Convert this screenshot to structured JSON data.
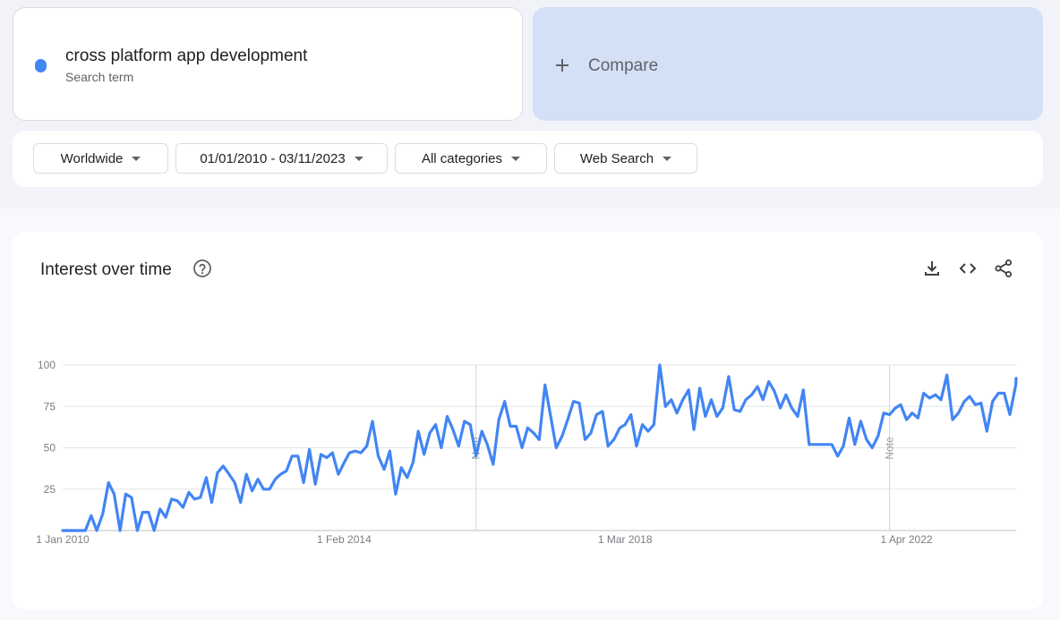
{
  "search_term": {
    "name": "cross platform app development",
    "sublabel": "Search term",
    "color": "#4285f4"
  },
  "compare": {
    "label": "Compare",
    "icon": "plus-icon"
  },
  "filters": {
    "region": "Worldwide",
    "date_range": "01/01/2010 - 03/11/2023",
    "category": "All categories",
    "search_type": "Web Search"
  },
  "panel": {
    "title": "Interest over time",
    "icons": [
      "help-icon",
      "download-icon",
      "embed-code-icon",
      "share-icon"
    ]
  },
  "chart_data": {
    "type": "line",
    "title": "",
    "xlabel": "",
    "ylabel": "",
    "ylim": [
      0,
      100
    ],
    "y_ticks": [
      25,
      50,
      75,
      100
    ],
    "x_range": [
      "2010-01-01",
      "2023-11-03"
    ],
    "x_ticks": [
      {
        "date": "2010-01-01",
        "label": "1 Jan 2010"
      },
      {
        "date": "2014-02-01",
        "label": "1 Feb 2014"
      },
      {
        "date": "2018-03-01",
        "label": "1 Mar 2018"
      },
      {
        "date": "2022-04-01",
        "label": "1 Apr 2022"
      }
    ],
    "notes": [
      {
        "date": "2016-01-01",
        "label": "Note"
      },
      {
        "date": "2022-01-01",
        "label": "Note"
      }
    ],
    "grid": true,
    "legend": "none",
    "series": [
      {
        "color": "#4285f4",
        "points": [
          [
            "2010-01-01",
            0
          ],
          [
            "2010-02-01",
            0
          ],
          [
            "2010-03-01",
            0
          ],
          [
            "2010-04-01",
            0
          ],
          [
            "2010-05-01",
            0
          ],
          [
            "2010-06-01",
            9
          ],
          [
            "2010-07-01",
            0
          ],
          [
            "2010-08-01",
            10
          ],
          [
            "2010-09-01",
            29
          ],
          [
            "2010-10-01",
            22
          ],
          [
            "2010-11-01",
            0
          ],
          [
            "2010-12-01",
            22
          ],
          [
            "2011-01-01",
            20
          ],
          [
            "2011-02-01",
            0
          ],
          [
            "2011-03-01",
            11
          ],
          [
            "2011-04-01",
            11
          ],
          [
            "2011-05-01",
            0
          ],
          [
            "2011-06-01",
            13
          ],
          [
            "2011-07-01",
            8
          ],
          [
            "2011-08-01",
            19
          ],
          [
            "2011-09-01",
            18
          ],
          [
            "2011-10-01",
            14
          ],
          [
            "2011-11-01",
            23
          ],
          [
            "2011-12-01",
            19
          ],
          [
            "2012-01-01",
            20
          ],
          [
            "2012-02-01",
            32
          ],
          [
            "2012-03-01",
            17
          ],
          [
            "2012-04-01",
            35
          ],
          [
            "2012-05-01",
            39
          ],
          [
            "2012-06-01",
            34
          ],
          [
            "2012-07-01",
            29
          ],
          [
            "2012-08-01",
            17
          ],
          [
            "2012-09-01",
            34
          ],
          [
            "2012-10-01",
            24
          ],
          [
            "2012-11-01",
            31
          ],
          [
            "2012-12-01",
            25
          ],
          [
            "2013-01-01",
            25
          ],
          [
            "2013-02-01",
            31
          ],
          [
            "2013-03-01",
            34
          ],
          [
            "2013-04-01",
            36
          ],
          [
            "2013-05-01",
            45
          ],
          [
            "2013-06-01",
            45
          ],
          [
            "2013-07-01",
            29
          ],
          [
            "2013-08-01",
            49
          ],
          [
            "2013-09-01",
            28
          ],
          [
            "2013-10-01",
            46
          ],
          [
            "2013-11-01",
            44
          ],
          [
            "2013-12-01",
            47
          ],
          [
            "2014-01-01",
            34
          ],
          [
            "2014-02-01",
            41
          ],
          [
            "2014-03-01",
            47
          ],
          [
            "2014-04-01",
            48
          ],
          [
            "2014-05-01",
            47
          ],
          [
            "2014-06-01",
            51
          ],
          [
            "2014-07-01",
            66
          ],
          [
            "2014-08-01",
            45
          ],
          [
            "2014-09-01",
            37
          ],
          [
            "2014-10-01",
            48
          ],
          [
            "2014-11-01",
            22
          ],
          [
            "2014-12-01",
            38
          ],
          [
            "2015-01-01",
            32
          ],
          [
            "2015-02-01",
            41
          ],
          [
            "2015-03-01",
            60
          ],
          [
            "2015-04-01",
            46
          ],
          [
            "2015-05-01",
            59
          ],
          [
            "2015-06-01",
            64
          ],
          [
            "2015-07-01",
            50
          ],
          [
            "2015-08-01",
            69
          ],
          [
            "2015-09-01",
            61
          ],
          [
            "2015-10-01",
            51
          ],
          [
            "2015-11-01",
            66
          ],
          [
            "2015-12-01",
            64
          ],
          [
            "2016-01-01",
            45
          ],
          [
            "2016-02-01",
            60
          ],
          [
            "2016-03-01",
            52
          ],
          [
            "2016-04-01",
            40
          ],
          [
            "2016-05-01",
            67
          ],
          [
            "2016-06-01",
            78
          ],
          [
            "2016-07-01",
            63
          ],
          [
            "2016-08-01",
            63
          ],
          [
            "2016-09-01",
            50
          ],
          [
            "2016-10-01",
            62
          ],
          [
            "2016-11-01",
            59
          ],
          [
            "2016-12-01",
            55
          ],
          [
            "2017-01-01",
            88
          ],
          [
            "2017-02-01",
            68
          ],
          [
            "2017-03-01",
            50
          ],
          [
            "2017-04-01",
            57
          ],
          [
            "2017-05-01",
            67
          ],
          [
            "2017-06-01",
            78
          ],
          [
            "2017-07-01",
            77
          ],
          [
            "2017-08-01",
            55
          ],
          [
            "2017-09-01",
            59
          ],
          [
            "2017-10-01",
            70
          ],
          [
            "2017-11-01",
            72
          ],
          [
            "2017-12-01",
            51
          ],
          [
            "2018-01-01",
            55
          ],
          [
            "2018-02-01",
            62
          ],
          [
            "2018-03-01",
            64
          ],
          [
            "2018-04-01",
            70
          ],
          [
            "2018-05-01",
            51
          ],
          [
            "2018-06-01",
            64
          ],
          [
            "2018-07-01",
            60
          ],
          [
            "2018-08-01",
            64
          ],
          [
            "2018-09-01",
            100
          ],
          [
            "2018-10-01",
            75
          ],
          [
            "2018-11-01",
            79
          ],
          [
            "2018-12-01",
            71
          ],
          [
            "2019-01-01",
            79
          ],
          [
            "2019-02-01",
            85
          ],
          [
            "2019-03-01",
            61
          ],
          [
            "2019-04-01",
            86
          ],
          [
            "2019-05-01",
            69
          ],
          [
            "2019-06-01",
            79
          ],
          [
            "2019-07-01",
            69
          ],
          [
            "2019-08-01",
            74
          ],
          [
            "2019-09-01",
            93
          ],
          [
            "2019-10-01",
            73
          ],
          [
            "2019-11-01",
            72
          ],
          [
            "2019-12-01",
            79
          ],
          [
            "2020-01-01",
            82
          ],
          [
            "2020-02-01",
            87
          ],
          [
            "2020-03-01",
            79
          ],
          [
            "2020-04-01",
            90
          ],
          [
            "2020-05-01",
            84
          ],
          [
            "2020-06-01",
            74
          ],
          [
            "2020-07-01",
            82
          ],
          [
            "2020-08-01",
            74
          ],
          [
            "2020-09-01",
            69
          ],
          [
            "2020-10-01",
            85
          ],
          [
            "2020-11-01",
            52
          ],
          [
            "2020-12-01",
            52
          ],
          [
            "2021-01-01",
            52
          ],
          [
            "2021-02-01",
            52
          ],
          [
            "2021-03-01",
            52
          ],
          [
            "2021-04-01",
            45
          ],
          [
            "2021-05-01",
            51
          ],
          [
            "2021-06-01",
            68
          ],
          [
            "2021-07-01",
            52
          ],
          [
            "2021-08-01",
            66
          ],
          [
            "2021-09-01",
            55
          ],
          [
            "2021-10-01",
            50
          ],
          [
            "2021-11-01",
            57
          ],
          [
            "2021-12-01",
            71
          ],
          [
            "2022-01-01",
            70
          ],
          [
            "2022-02-01",
            74
          ],
          [
            "2022-03-01",
            76
          ],
          [
            "2022-04-01",
            67
          ],
          [
            "2022-05-01",
            71
          ],
          [
            "2022-06-01",
            68
          ],
          [
            "2022-07-01",
            83
          ],
          [
            "2022-08-01",
            80
          ],
          [
            "2022-09-01",
            82
          ],
          [
            "2022-10-01",
            79
          ],
          [
            "2022-11-01",
            94
          ],
          [
            "2022-12-01",
            67
          ],
          [
            "2023-01-01",
            71
          ],
          [
            "2023-02-01",
            78
          ],
          [
            "2023-03-01",
            81
          ],
          [
            "2023-04-01",
            76
          ],
          [
            "2023-05-01",
            77
          ],
          [
            "2023-06-01",
            60
          ],
          [
            "2023-07-01",
            78
          ],
          [
            "2023-08-01",
            83
          ],
          [
            "2023-09-01",
            83
          ],
          [
            "2023-10-01",
            70
          ],
          [
            "2023-11-01",
            88
          ],
          [
            "2023-11-03",
            92
          ]
        ]
      }
    ]
  }
}
